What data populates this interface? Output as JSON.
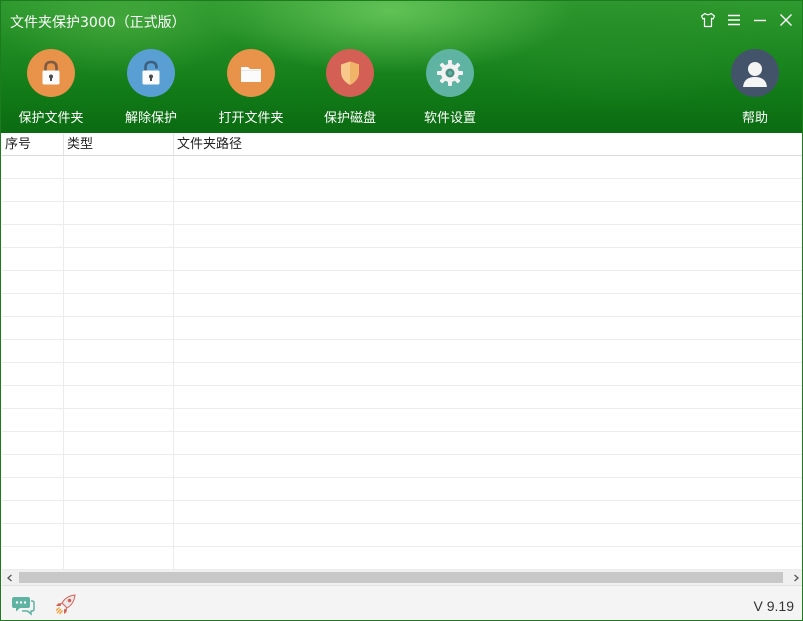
{
  "window": {
    "title": "文件夹保护3000（正式版）"
  },
  "toolbar": {
    "protect_folder": "保护文件夹",
    "unprotect": "解除保护",
    "open_folder": "打开文件夹",
    "protect_disk": "保护磁盘",
    "settings": "软件设置",
    "help": "帮助"
  },
  "table": {
    "columns": [
      "序号",
      "类型",
      "文件夹路径"
    ],
    "rows": []
  },
  "status": {
    "version": "V 9.19"
  },
  "colors": {
    "header_green": "#117a17",
    "lock_orange": "#e8924a",
    "unlock_blue": "#5a9fd4",
    "folder_orange": "#e8924a",
    "shield_red": "#d35f55",
    "gear_teal": "#5fb3a3",
    "avatar_navy": "#43536a"
  }
}
